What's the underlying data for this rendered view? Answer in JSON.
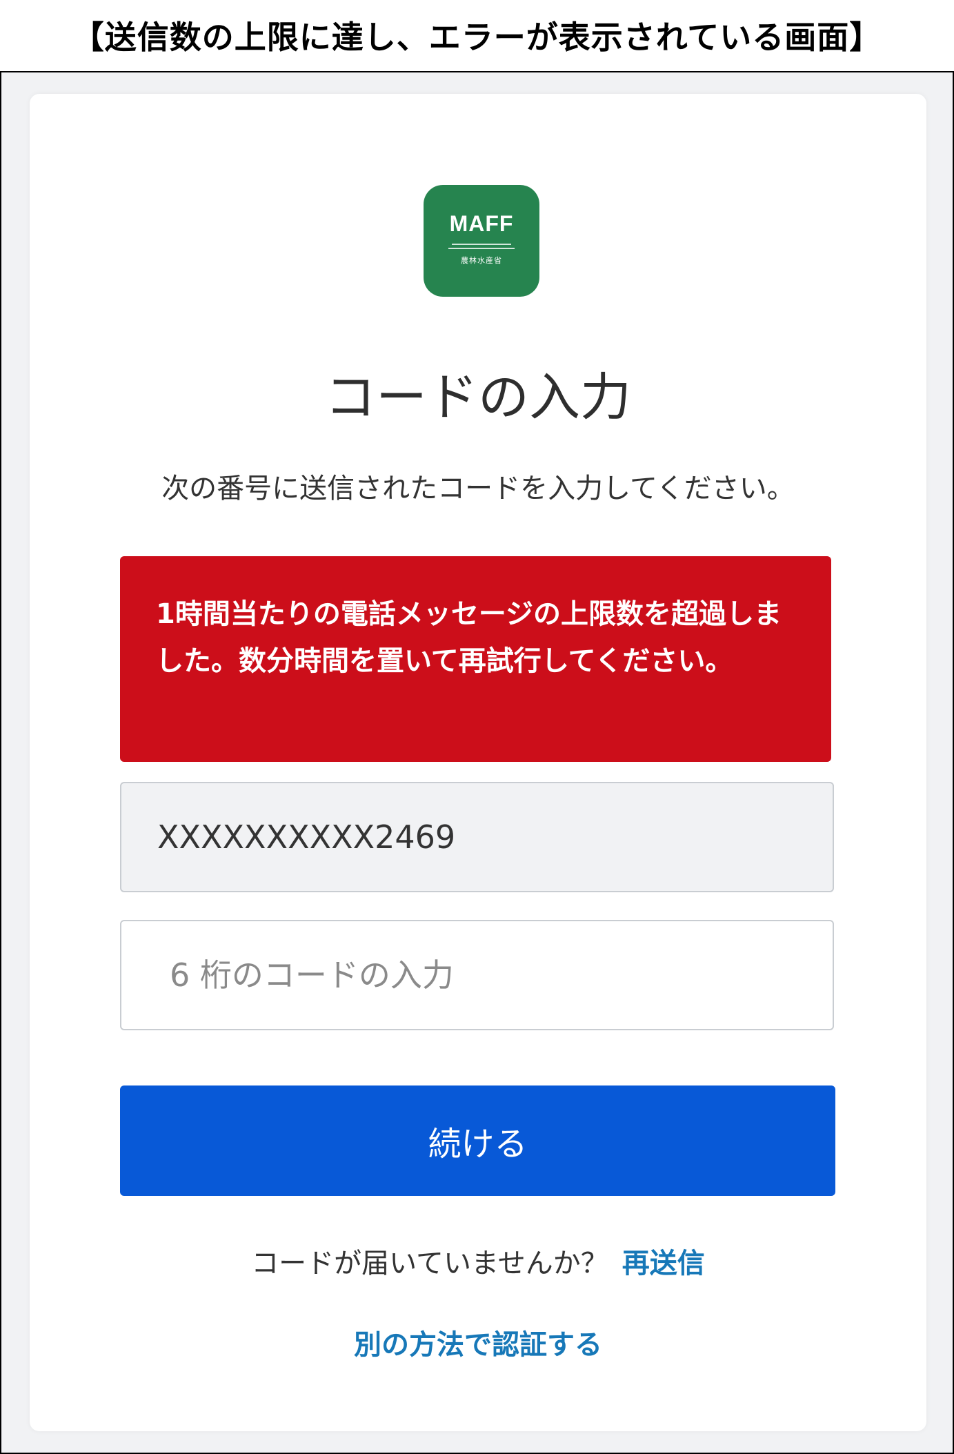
{
  "caption": "【送信数の上限に達し、エラーが表示されている画面】",
  "logo": {
    "text": "MAFF",
    "kanji": "農林水産省",
    "icon": "maff-logo-icon",
    "color": "#26844f"
  },
  "page_title": "コードの入力",
  "instruction": "次の番号に送信されたコードを入力してください。",
  "error": {
    "message": "1時間当たりの電話メッセージの上限数を超過しました。数分時間を置いて再試行してください。",
    "color": "#cc0e1a"
  },
  "phone_field": {
    "value": "XXXXXXXXXX2469"
  },
  "code_field": {
    "placeholder": "6 桁のコードの入力"
  },
  "continue_button": {
    "label": "続ける",
    "color": "#0859d7"
  },
  "resend": {
    "prompt": "コードが届いていませんか？",
    "link_label": "再送信"
  },
  "alt_method": {
    "label": "別の方法で認証する"
  }
}
